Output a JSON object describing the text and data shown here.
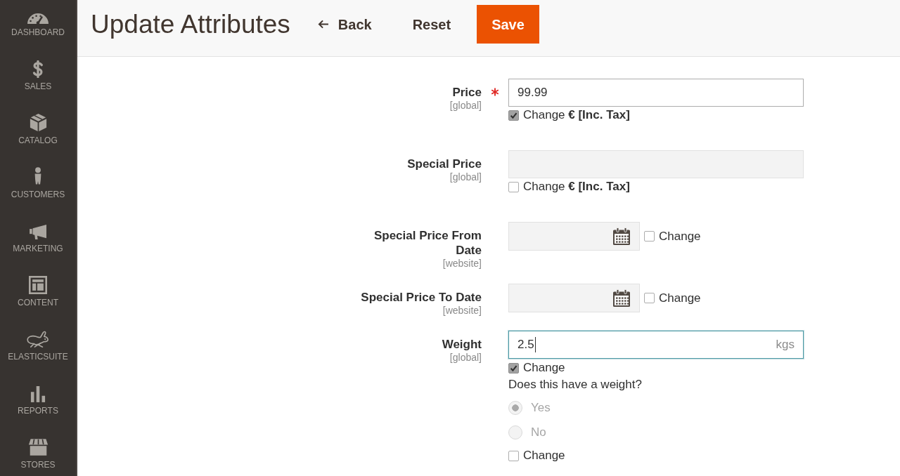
{
  "sidebar": {
    "items": [
      {
        "label": "DASHBOARD"
      },
      {
        "label": "SALES"
      },
      {
        "label": "CATALOG"
      },
      {
        "label": "CUSTOMERS"
      },
      {
        "label": "MARKETING"
      },
      {
        "label": "CONTENT"
      },
      {
        "label": "ELASTICSUITE"
      },
      {
        "label": "REPORTS"
      },
      {
        "label": "STORES"
      }
    ]
  },
  "header": {
    "title": "Update Attributes",
    "back": "Back",
    "reset": "Reset",
    "save": "Save"
  },
  "form": {
    "fields": [
      {
        "kind": "text",
        "label": "Price",
        "scope": "[global]",
        "required": true,
        "value": "99.99",
        "disabled": false,
        "focused": false,
        "change": {
          "label": "Change **€ [Inc. Tax]**",
          "checked": true
        }
      },
      {
        "kind": "text",
        "label": "Special Price",
        "scope": "[global]",
        "required": false,
        "disabled": true,
        "focused": false,
        "change": {
          "label": "Change **€ [Inc. Tax]**",
          "checked": false
        }
      },
      {
        "kind": "date",
        "label": "Special Price From Date",
        "scope": "[website]",
        "required": false,
        "disabled": true,
        "focused": false,
        "change": {
          "label": "Change",
          "checked": false
        }
      },
      {
        "kind": "date",
        "label": "Special Price To Date",
        "scope": "[website]",
        "required": false,
        "disabled": true,
        "focused": false,
        "change": {
          "label": "Change",
          "checked": false
        }
      },
      {
        "kind": "weight",
        "label": "Weight",
        "scope": "[global]",
        "required": false,
        "value": "2.5",
        "suffix": "kgs",
        "disabled": false,
        "focused": true,
        "change": {
          "label": "Change",
          "checked": true
        },
        "weight_question": {
          "question": "Does this have a weight?",
          "disabled": true,
          "options": [
            {
              "label": "Yes",
              "selected": true
            },
            {
              "label": "No",
              "selected": false
            }
          ],
          "change": {
            "label": "Change",
            "checked": false
          }
        }
      }
    ]
  }
}
